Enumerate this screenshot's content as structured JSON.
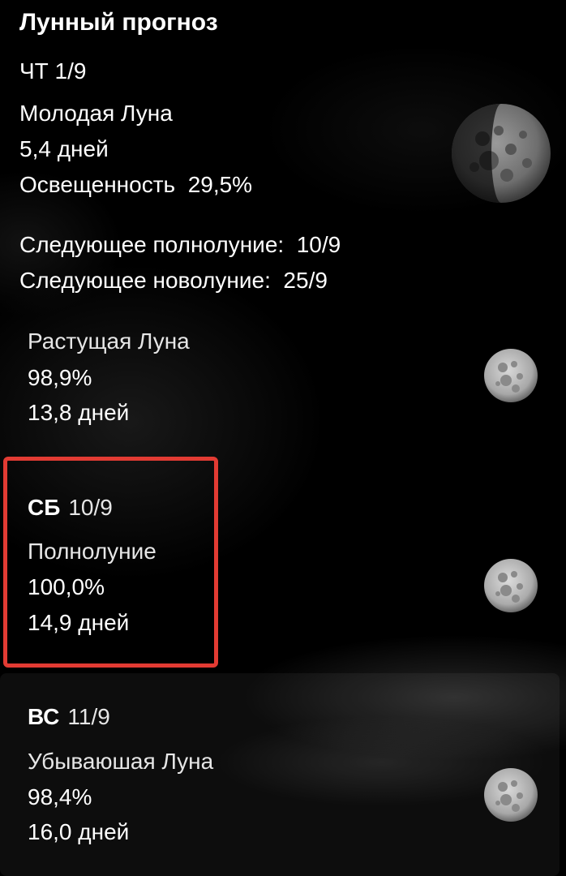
{
  "header": {
    "title": "Лунный прогноз"
  },
  "today": {
    "date": "ЧТ 1/9",
    "phase": "Молодая Луна",
    "age": "5,4 дней",
    "illumination_label": "Освещенность",
    "illumination_value": "29,5%",
    "next_full_label": "Следующее полнолуние:",
    "next_full_value": "10/9",
    "next_new_label": "Следующее новолуние:",
    "next_new_value": "25/9",
    "moon_icon": "waxing-crescent-moon-icon"
  },
  "forecast": [
    {
      "phase": "Растущая Луна",
      "illumination": "98,9%",
      "age": "13,8 дней",
      "moon_icon": "waxing-gibbous-moon-icon"
    },
    {
      "day": "СБ",
      "date": "10/9",
      "phase": "Полнолуние",
      "illumination": "100,0%",
      "age": "14,9 дней",
      "moon_icon": "full-moon-icon"
    },
    {
      "day": "ВС",
      "date": "11/9",
      "phase": "Убываюшая Луна",
      "illumination": "98,4%",
      "age": "16,0 дней",
      "moon_icon": "waning-gibbous-moon-icon"
    }
  ],
  "colors": {
    "background": "#000000",
    "text": "#ffffff",
    "highlight_border": "#e23b33"
  }
}
